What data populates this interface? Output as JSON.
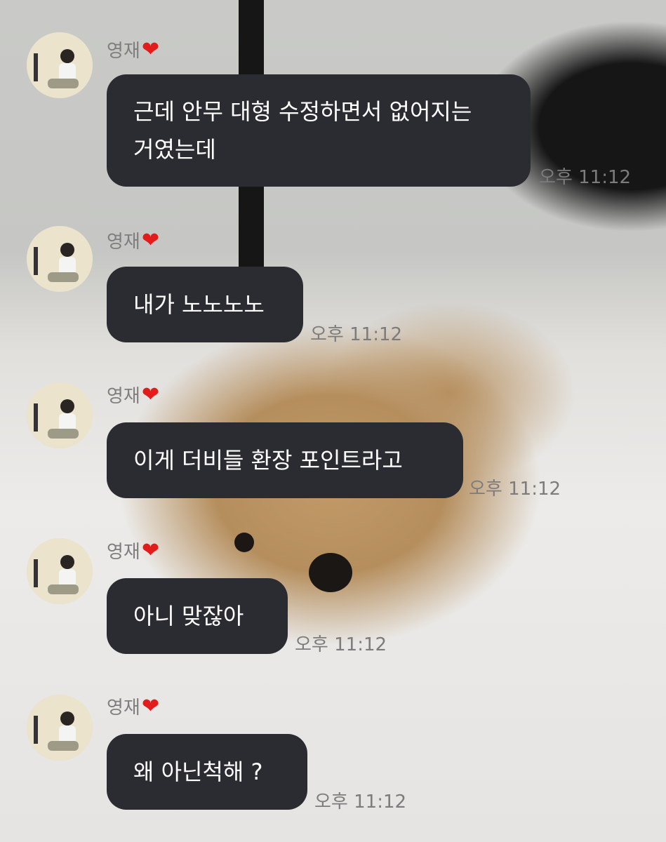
{
  "messages": [
    {
      "sender": "영재",
      "text_lines": [
        "근데 안무 대형 수정하면서 없어지는",
        "거였는데"
      ],
      "time": "오후 11:12"
    },
    {
      "sender": "영재",
      "text_lines": [
        "내가 노노노노"
      ],
      "time": "오후 11:12"
    },
    {
      "sender": "영재",
      "text_lines": [
        "이게 더비들 환장 포인트라고"
      ],
      "time": "오후 11:12"
    },
    {
      "sender": "영재",
      "text_lines": [
        "아니 맞잖아"
      ],
      "time": "오후 11:12"
    },
    {
      "sender": "영재",
      "text_lines": [
        "왜 아닌척해 ?"
      ],
      "time": "오후 11:12"
    }
  ],
  "heart_glyph": "❤",
  "icons": {
    "avatar": "profile-photo",
    "heart": "red-heart-emoji"
  },
  "colors": {
    "bubble": "#2b2c31",
    "bubble_text": "#ffffff",
    "meta_text": "#7e7e7e",
    "heart": "#e21b1b"
  }
}
